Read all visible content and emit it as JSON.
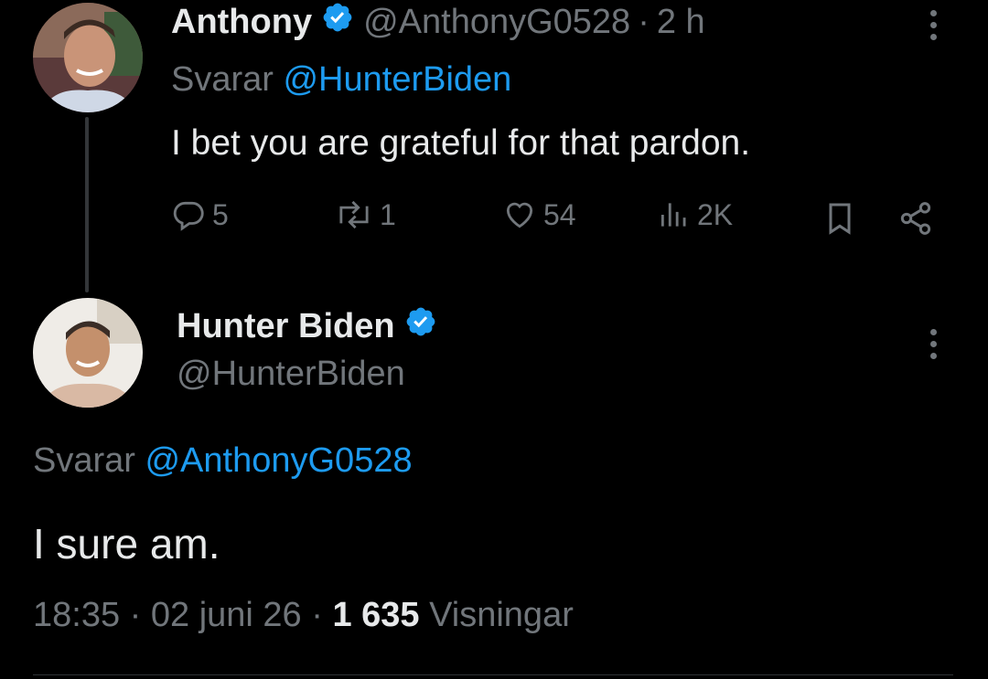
{
  "reply_tweet": {
    "display_name": "Anthony",
    "handle": "@AnthonyG0528",
    "separator": "·",
    "time_ago": "2 h",
    "replying_prefix": "Svarar",
    "replying_to": "@HunterBiden",
    "text": "I bet you are grateful for that pardon.",
    "actions": {
      "replies": "5",
      "reposts": "1",
      "likes": "54",
      "views": "2K"
    }
  },
  "main_tweet": {
    "display_name": "Hunter Biden",
    "handle": "@HunterBiden",
    "replying_prefix": "Svarar",
    "replying_to": "@AnthonyG0528",
    "text": "I sure am.",
    "time": "18:35",
    "date": "02 juni 26",
    "separator": "·",
    "views_count": "1 635",
    "views_label": "Visningar"
  },
  "colors": {
    "background": "#000000",
    "text_primary": "#e7e9ea",
    "text_muted": "#71767b",
    "accent": "#1d9bf0"
  },
  "icons": [
    "verified-badge-icon",
    "more-icon",
    "reply-icon",
    "repost-icon",
    "like-icon",
    "views-icon",
    "bookmark-icon",
    "share-icon"
  ]
}
